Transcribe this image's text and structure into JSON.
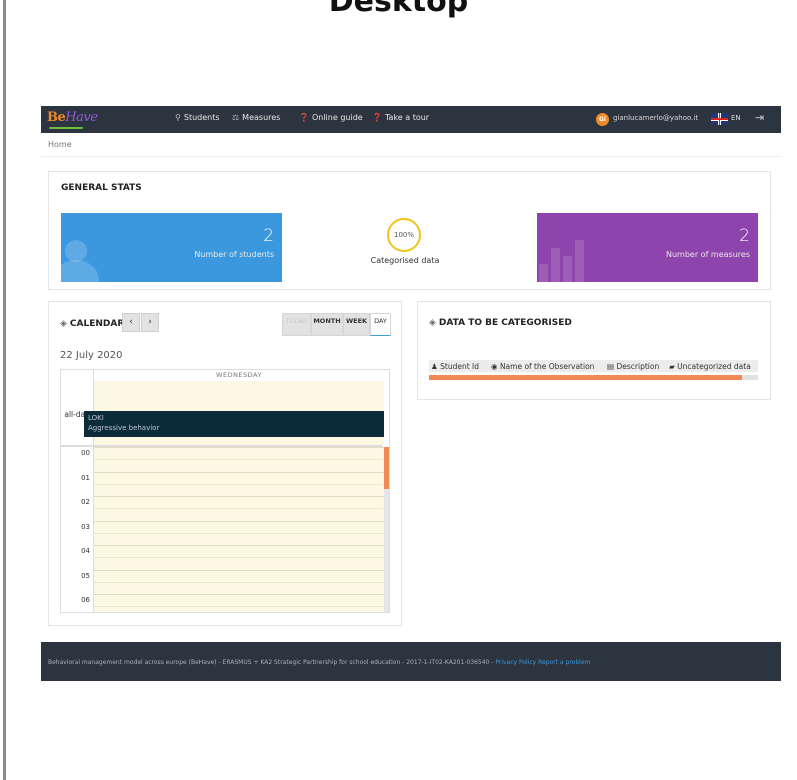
{
  "page_heading": "Desktop",
  "app": {
    "logo_be": "Be",
    "logo_have": "Have"
  },
  "nav": {
    "items": [
      {
        "icon": "graduation-icon",
        "label": "Students"
      },
      {
        "icon": "balance-icon",
        "label": "Measures"
      },
      {
        "icon": "help-icon",
        "label": "Online guide"
      },
      {
        "icon": "help-icon",
        "label": "Take a tour"
      }
    ],
    "avatar_initials": "Gi",
    "email": "gianlucamerlo@yahoo.it",
    "language": "EN"
  },
  "breadcrumb": "Home",
  "general_stats": {
    "title": "GENERAL STATS",
    "students": {
      "value": "2",
      "label": "Number of students"
    },
    "categorised": {
      "percent": "100%",
      "label": "Categorised data"
    },
    "measures": {
      "value": "2",
      "label": "Number of measures"
    }
  },
  "calendar": {
    "title": "CALENDAR",
    "prev": "‹",
    "next": "›",
    "views": [
      "TODAY",
      "MONTH",
      "WEEK",
      "DAY"
    ],
    "date": "22 July 2020",
    "day_header": "WEDNESDAY",
    "allday_label": "all-day",
    "event": {
      "student": "LOKI",
      "measure": "Aggressive behavior"
    },
    "hours": [
      "00",
      "01",
      "02",
      "03",
      "04",
      "05",
      "06"
    ]
  },
  "data_to_categorise": {
    "title": "DATA TO BE CATEGORISED",
    "columns": [
      "Student Id",
      "Name of the Observation",
      "Description",
      "Uncategorized data"
    ]
  },
  "footer": {
    "text": "Behavioral management model across europe (BeHave) - ERASMUS + KA2 Strategic Partnership for school education - 2017-1-IT02-KA201-036540 -",
    "privacy": "Privacy Policy",
    "report": "Report a problem"
  },
  "colors": {
    "nav_bg": "#2c3440",
    "stat_blue": "#3b98df",
    "stat_purple": "#8e44ad",
    "accent_orange": "#ef8a55",
    "event_bg": "#0d2c3b",
    "calendar_cell": "#fcf8e3"
  }
}
